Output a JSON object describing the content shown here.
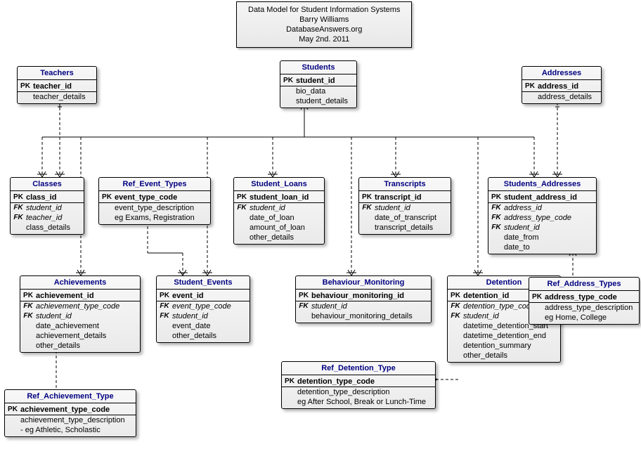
{
  "title": {
    "line1": "Data Model for Student Information Systems",
    "line2": "Barry Williams",
    "line3": "DatabaseAnswers.org",
    "line4": "May 2nd. 2011"
  },
  "entities": {
    "teachers": {
      "name": "Teachers",
      "pk": "teacher_id",
      "attrs": [
        "teacher_details"
      ]
    },
    "students": {
      "name": "Students",
      "pk": "student_id",
      "attrs": [
        "bio_data",
        "student_details"
      ]
    },
    "addresses": {
      "name": "Addresses",
      "pk": "address_id",
      "attrs": [
        "address_details"
      ]
    },
    "classes": {
      "name": "Classes",
      "pk": "class_id",
      "fks": [
        "student_id",
        "teacher_id"
      ],
      "attrs": [
        "class_details"
      ]
    },
    "ref_event_types": {
      "name": "Ref_Event_Types",
      "pk": "event_type_code",
      "attrs": [
        "event_type_description",
        "eg Exams, Registration"
      ]
    },
    "student_loans": {
      "name": "Student_Loans",
      "pk": "student_loan_id",
      "fks": [
        "student_id"
      ],
      "attrs": [
        "date_of_loan",
        "amount_of_loan",
        "other_details"
      ]
    },
    "transcripts": {
      "name": "Transcripts",
      "pk": "transcript_id",
      "fks": [
        "student_id"
      ],
      "attrs": [
        "date_of_transcript",
        "transcript_details"
      ]
    },
    "students_addresses": {
      "name": "Students_Addresses",
      "pk": "student_address_id",
      "fks": [
        "address_id",
        "address_type_code",
        "student_id"
      ],
      "attrs": [
        "date_from",
        "date_to"
      ]
    },
    "achievements": {
      "name": "Achievements",
      "pk": "achievement_id",
      "fks": [
        "achievement_type_code",
        "student_id"
      ],
      "attrs": [
        "date_achievement",
        "achievement_details",
        "other_details"
      ]
    },
    "student_events": {
      "name": "Student_Events",
      "pk": "event_id",
      "fks": [
        "event_type_code",
        "student_id"
      ],
      "attrs": [
        "event_date",
        "other_details"
      ]
    },
    "behaviour_monitoring": {
      "name": "Behaviour_Monitoring",
      "pk": "behaviour_monitoring_id",
      "fks": [
        "student_id"
      ],
      "attrs": [
        "behaviour_monitoring_details"
      ]
    },
    "detention": {
      "name": "Detention",
      "pk": "detention_id",
      "fks": [
        "detention_type_code",
        "student_id"
      ],
      "attrs": [
        "datetime_detention_start",
        "datetime_detention_end",
        "detention_summary",
        "other_details"
      ]
    },
    "ref_address_types": {
      "name": "Ref_Address_Types",
      "pk": "address_type_code",
      "attrs": [
        "address_type_description",
        "eg Home, College"
      ]
    },
    "ref_detention_type": {
      "name": "Ref_Detention_Type",
      "pk": "detention_type_code",
      "attrs": [
        "detention_type_description",
        "eg After School, Break or Lunch-Time"
      ]
    },
    "ref_achievement_type": {
      "name": "Ref_Achievement_Type",
      "pk": "achievement_type_code",
      "attrs": [
        "achievement_type_description",
        "- eg Athletic, Scholastic"
      ]
    }
  }
}
